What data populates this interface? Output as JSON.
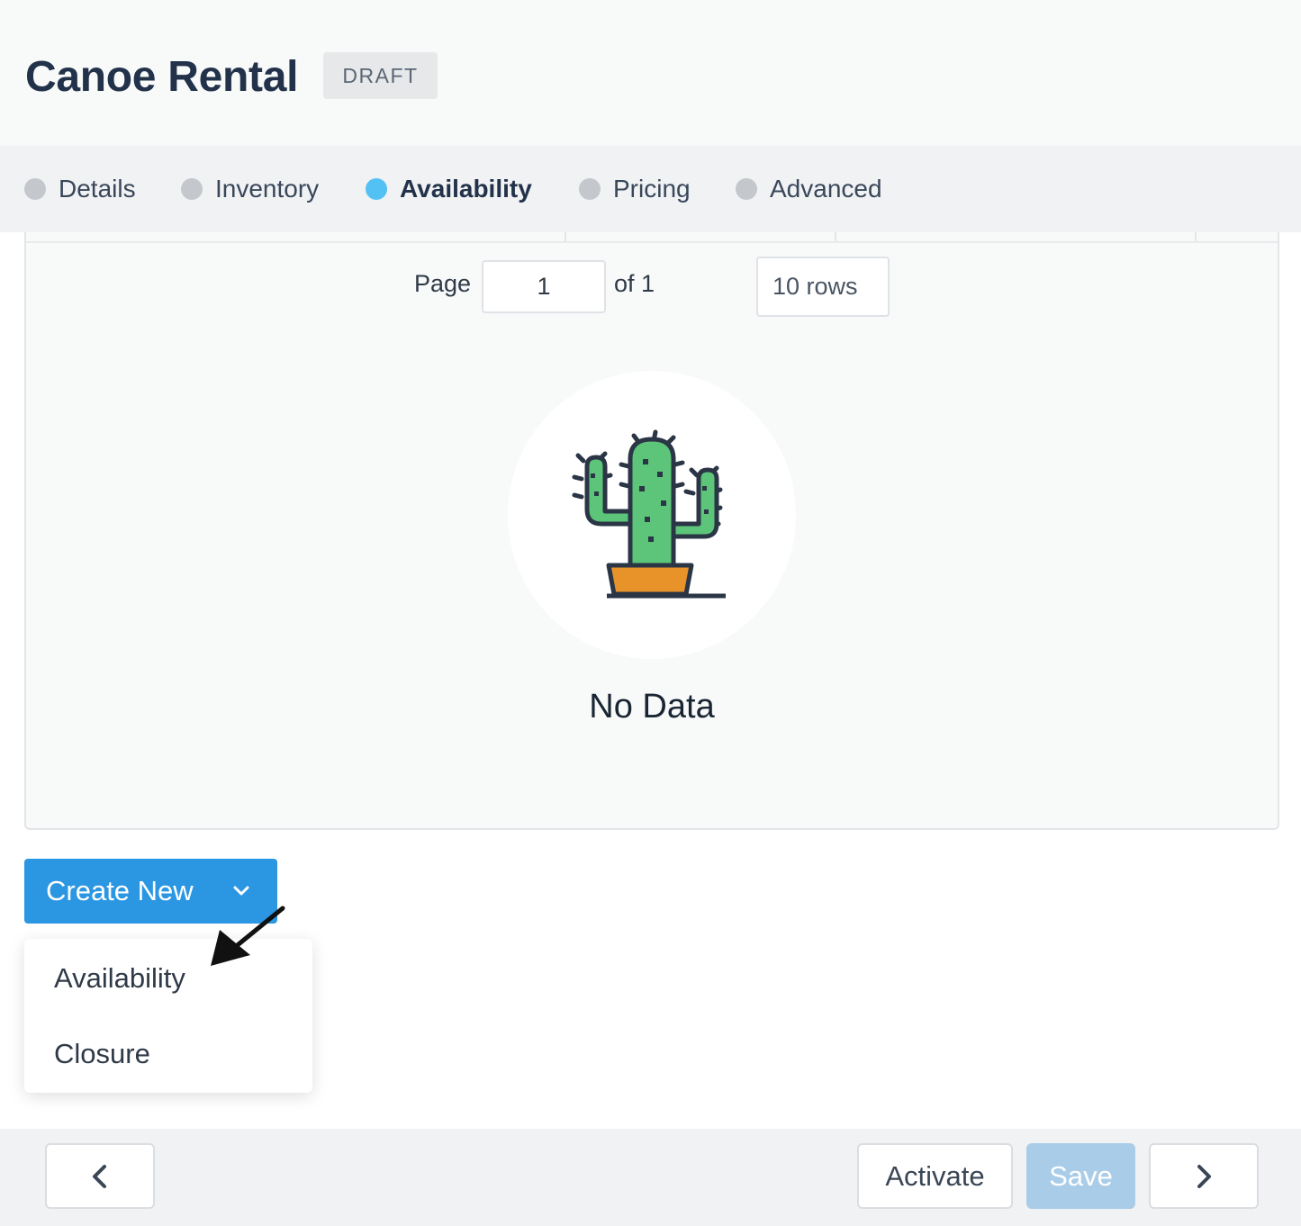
{
  "header": {
    "title": "Canoe Rental",
    "status": "DRAFT"
  },
  "tabs": [
    {
      "label": "Details",
      "active": false
    },
    {
      "label": "Inventory",
      "active": false
    },
    {
      "label": "Availability",
      "active": true
    },
    {
      "label": "Pricing",
      "active": false
    },
    {
      "label": "Advanced",
      "active": false
    }
  ],
  "pagination": {
    "page_label": "Page",
    "page_value": "1",
    "of_label": "of 1",
    "rows_label": "10 rows"
  },
  "empty_state": {
    "message": "No Data",
    "icon": "cactus-icon"
  },
  "create_menu": {
    "button_label": "Create New",
    "items": [
      "Availability",
      "Closure"
    ]
  },
  "footer": {
    "activate_label": "Activate",
    "save_label": "Save"
  },
  "colors": {
    "accent": "#2b96e2",
    "active_dot": "#54c1f5",
    "title": "#22324a"
  }
}
